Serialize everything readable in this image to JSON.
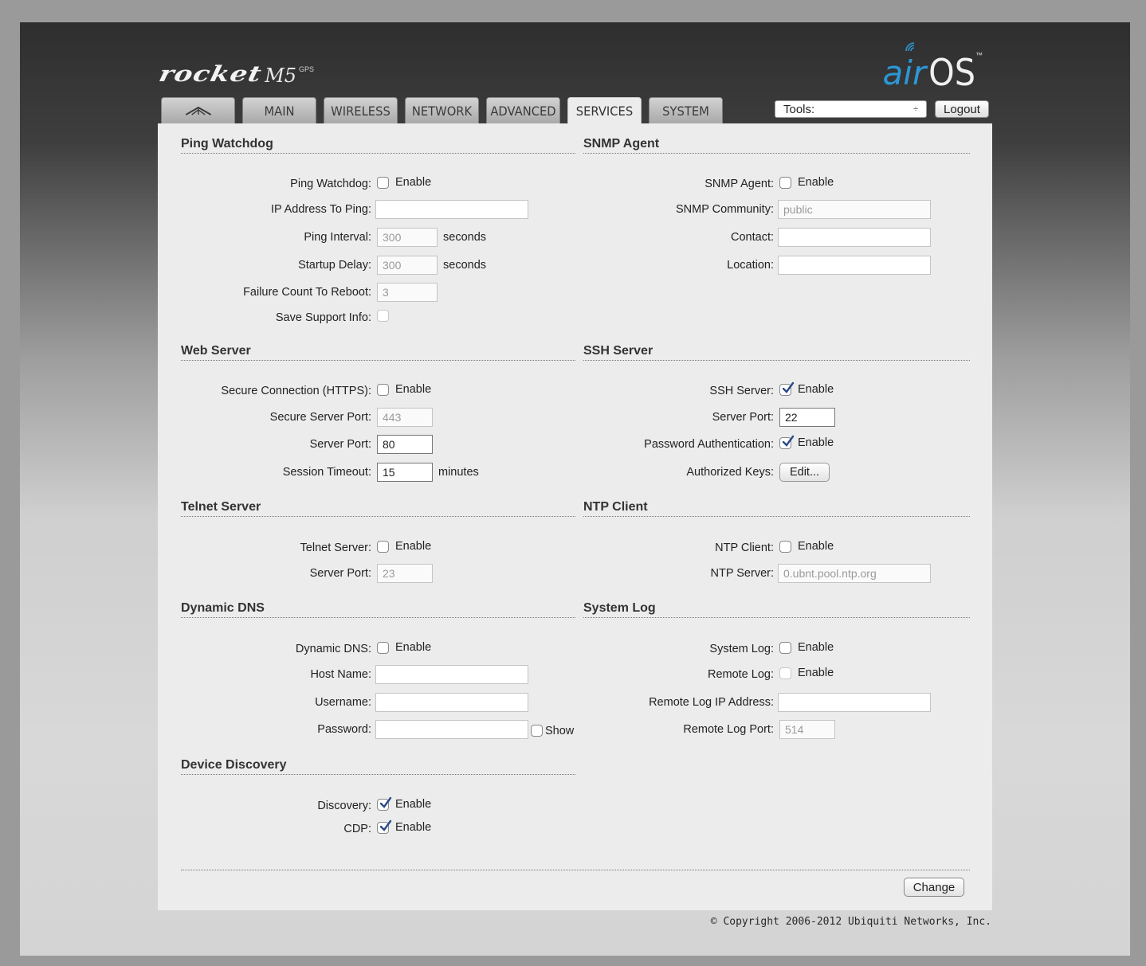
{
  "brand": {
    "product": "rocket",
    "model": "M5",
    "suffix": "GPS",
    "os_air": "air",
    "os_os": "OS",
    "os_tm": "™"
  },
  "tabs": [
    {
      "label": "",
      "icon": "ubiquiti-logo-icon"
    },
    {
      "label": "MAIN"
    },
    {
      "label": "WIRELESS"
    },
    {
      "label": "NETWORK"
    },
    {
      "label": "ADVANCED"
    },
    {
      "label": "SERVICES",
      "active": true
    },
    {
      "label": "SYSTEM"
    }
  ],
  "toolbar": {
    "tools_label": "Tools:",
    "tools_arrow": "÷",
    "logout_label": "Logout"
  },
  "enable_label": "Enable",
  "ping": {
    "title": "Ping Watchdog",
    "watchdog_label": "Ping Watchdog:",
    "ip_label": "IP Address To Ping:",
    "ip_value": "",
    "interval_label": "Ping Interval:",
    "interval_value": "300",
    "startup_label": "Startup Delay:",
    "startup_value": "300",
    "seconds": "seconds",
    "failure_label": "Failure Count To Reboot:",
    "failure_value": "3",
    "support_label": "Save Support Info:"
  },
  "snmp": {
    "title": "SNMP Agent",
    "agent_label": "SNMP Agent:",
    "community_label": "SNMP Community:",
    "community_value": "public",
    "contact_label": "Contact:",
    "contact_value": "",
    "location_label": "Location:",
    "location_value": ""
  },
  "web": {
    "title": "Web Server",
    "https_label": "Secure Connection (HTTPS):",
    "secure_port_label": "Secure Server Port:",
    "secure_port_value": "443",
    "port_label": "Server Port:",
    "port_value": "80",
    "timeout_label": "Session Timeout:",
    "timeout_value": "15",
    "minutes": "minutes"
  },
  "ssh": {
    "title": "SSH Server",
    "server_label": "SSH Server:",
    "port_label": "Server Port:",
    "port_value": "22",
    "password_label": "Password Authentication:",
    "keys_label": "Authorized Keys:",
    "edit_label": "Edit..."
  },
  "telnet": {
    "title": "Telnet Server",
    "server_label": "Telnet Server:",
    "port_label": "Server Port:",
    "port_value": "23"
  },
  "ntp": {
    "title": "NTP Client",
    "client_label": "NTP Client:",
    "server_label": "NTP Server:",
    "server_value": "0.ubnt.pool.ntp.org"
  },
  "ddns": {
    "title": "Dynamic DNS",
    "ddns_label": "Dynamic DNS:",
    "host_label": "Host Name:",
    "host_value": "",
    "user_label": "Username:",
    "user_value": "",
    "pass_label": "Password:",
    "pass_value": "",
    "show_label": "Show"
  },
  "syslog": {
    "title": "System Log",
    "log_label": "System Log:",
    "remote_label": "Remote Log:",
    "remote_ip_label": "Remote Log IP Address:",
    "remote_ip_value": "",
    "remote_port_label": "Remote Log Port:",
    "remote_port_value": "514"
  },
  "discovery": {
    "title": "Device Discovery",
    "discovery_label": "Discovery:",
    "cdp_label": "CDP:"
  },
  "change_label": "Change",
  "copyright": "© Copyright 2006-2012 Ubiquiti Networks, Inc.",
  "colors": {
    "accent": "#2b97d6",
    "panel": "#ececec"
  }
}
